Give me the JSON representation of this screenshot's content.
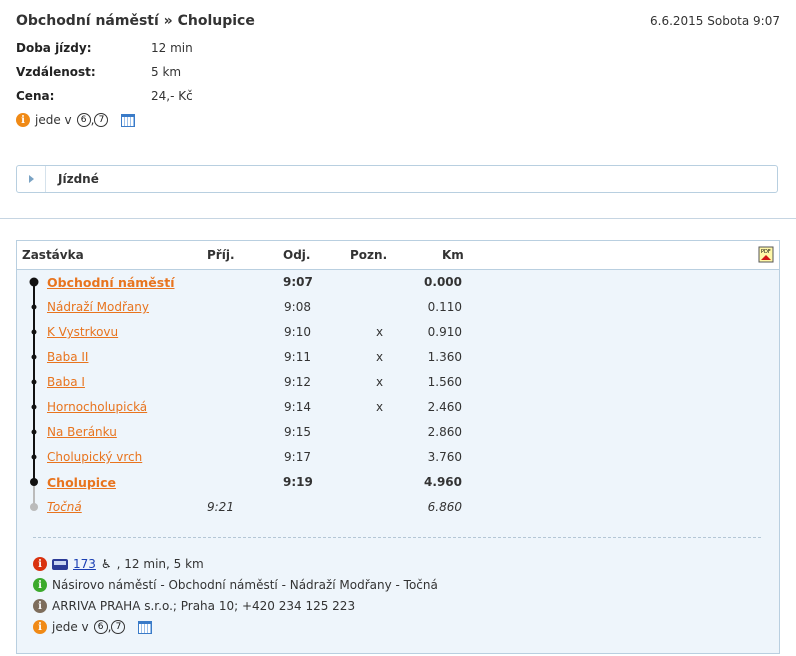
{
  "header": {
    "title": "Obchodní náměstí » Cholupice",
    "date": "6.6.2015 Sobota 9:07"
  },
  "info": [
    {
      "label": "Doba jízdy:",
      "value": "12 min"
    },
    {
      "label": "Vzdálenost:",
      "value": "5 km"
    },
    {
      "label": "Cena:",
      "value": "24,- Kč"
    }
  ],
  "note": {
    "text": "jede v",
    "days": [
      "6",
      "7"
    ],
    "separator": ","
  },
  "fares_section": {
    "label": "Jízdné"
  },
  "table": {
    "headers": {
      "stop": "Zastávka",
      "arr": "Příj.",
      "dep": "Odj.",
      "note": "Pozn.",
      "km": "Km"
    },
    "rows": [
      {
        "name": "Obchodní náměstí",
        "arr": "",
        "dep": "9:07",
        "note": "",
        "km": "0.000"
      },
      {
        "name": "Nádraží Modřany",
        "arr": "",
        "dep": "9:08",
        "note": "",
        "km": "0.110"
      },
      {
        "name": "K Vystrkovu",
        "arr": "",
        "dep": "9:10",
        "note": "x",
        "km": "0.910"
      },
      {
        "name": "Baba II",
        "arr": "",
        "dep": "9:11",
        "note": "x",
        "km": "1.360"
      },
      {
        "name": "Baba I",
        "arr": "",
        "dep": "9:12",
        "note": "x",
        "km": "1.560"
      },
      {
        "name": "Hornocholupická",
        "arr": "",
        "dep": "9:14",
        "note": "x",
        "km": "2.460"
      },
      {
        "name": "Na Beránku",
        "arr": "",
        "dep": "9:15",
        "note": "",
        "km": "2.860"
      },
      {
        "name": "Cholupický vrch",
        "arr": "",
        "dep": "9:17",
        "note": "",
        "km": "3.760"
      },
      {
        "name": "Cholupice",
        "arr": "",
        "dep": "9:19",
        "note": "",
        "km": "4.960"
      },
      {
        "name": "Točná",
        "arr": "9:21",
        "dep": "",
        "note": "",
        "km": "6.860"
      }
    ]
  },
  "footer": {
    "line_number": "173",
    "line_info": ", 12 min, 5 km",
    "route": "Násirovo náměstí - Obchodní náměstí - Nádraží Modřany - Točná",
    "carrier": "ARRIVA PRAHA s.r.o.; Praha 10; +420 234 125 223",
    "note_text": "jede v",
    "days": [
      "6",
      "7"
    ],
    "separator": ","
  },
  "colors": {
    "link": "#e8741e",
    "accent_border": "#b9cfe0",
    "panel_bg": "#eef5fb"
  }
}
